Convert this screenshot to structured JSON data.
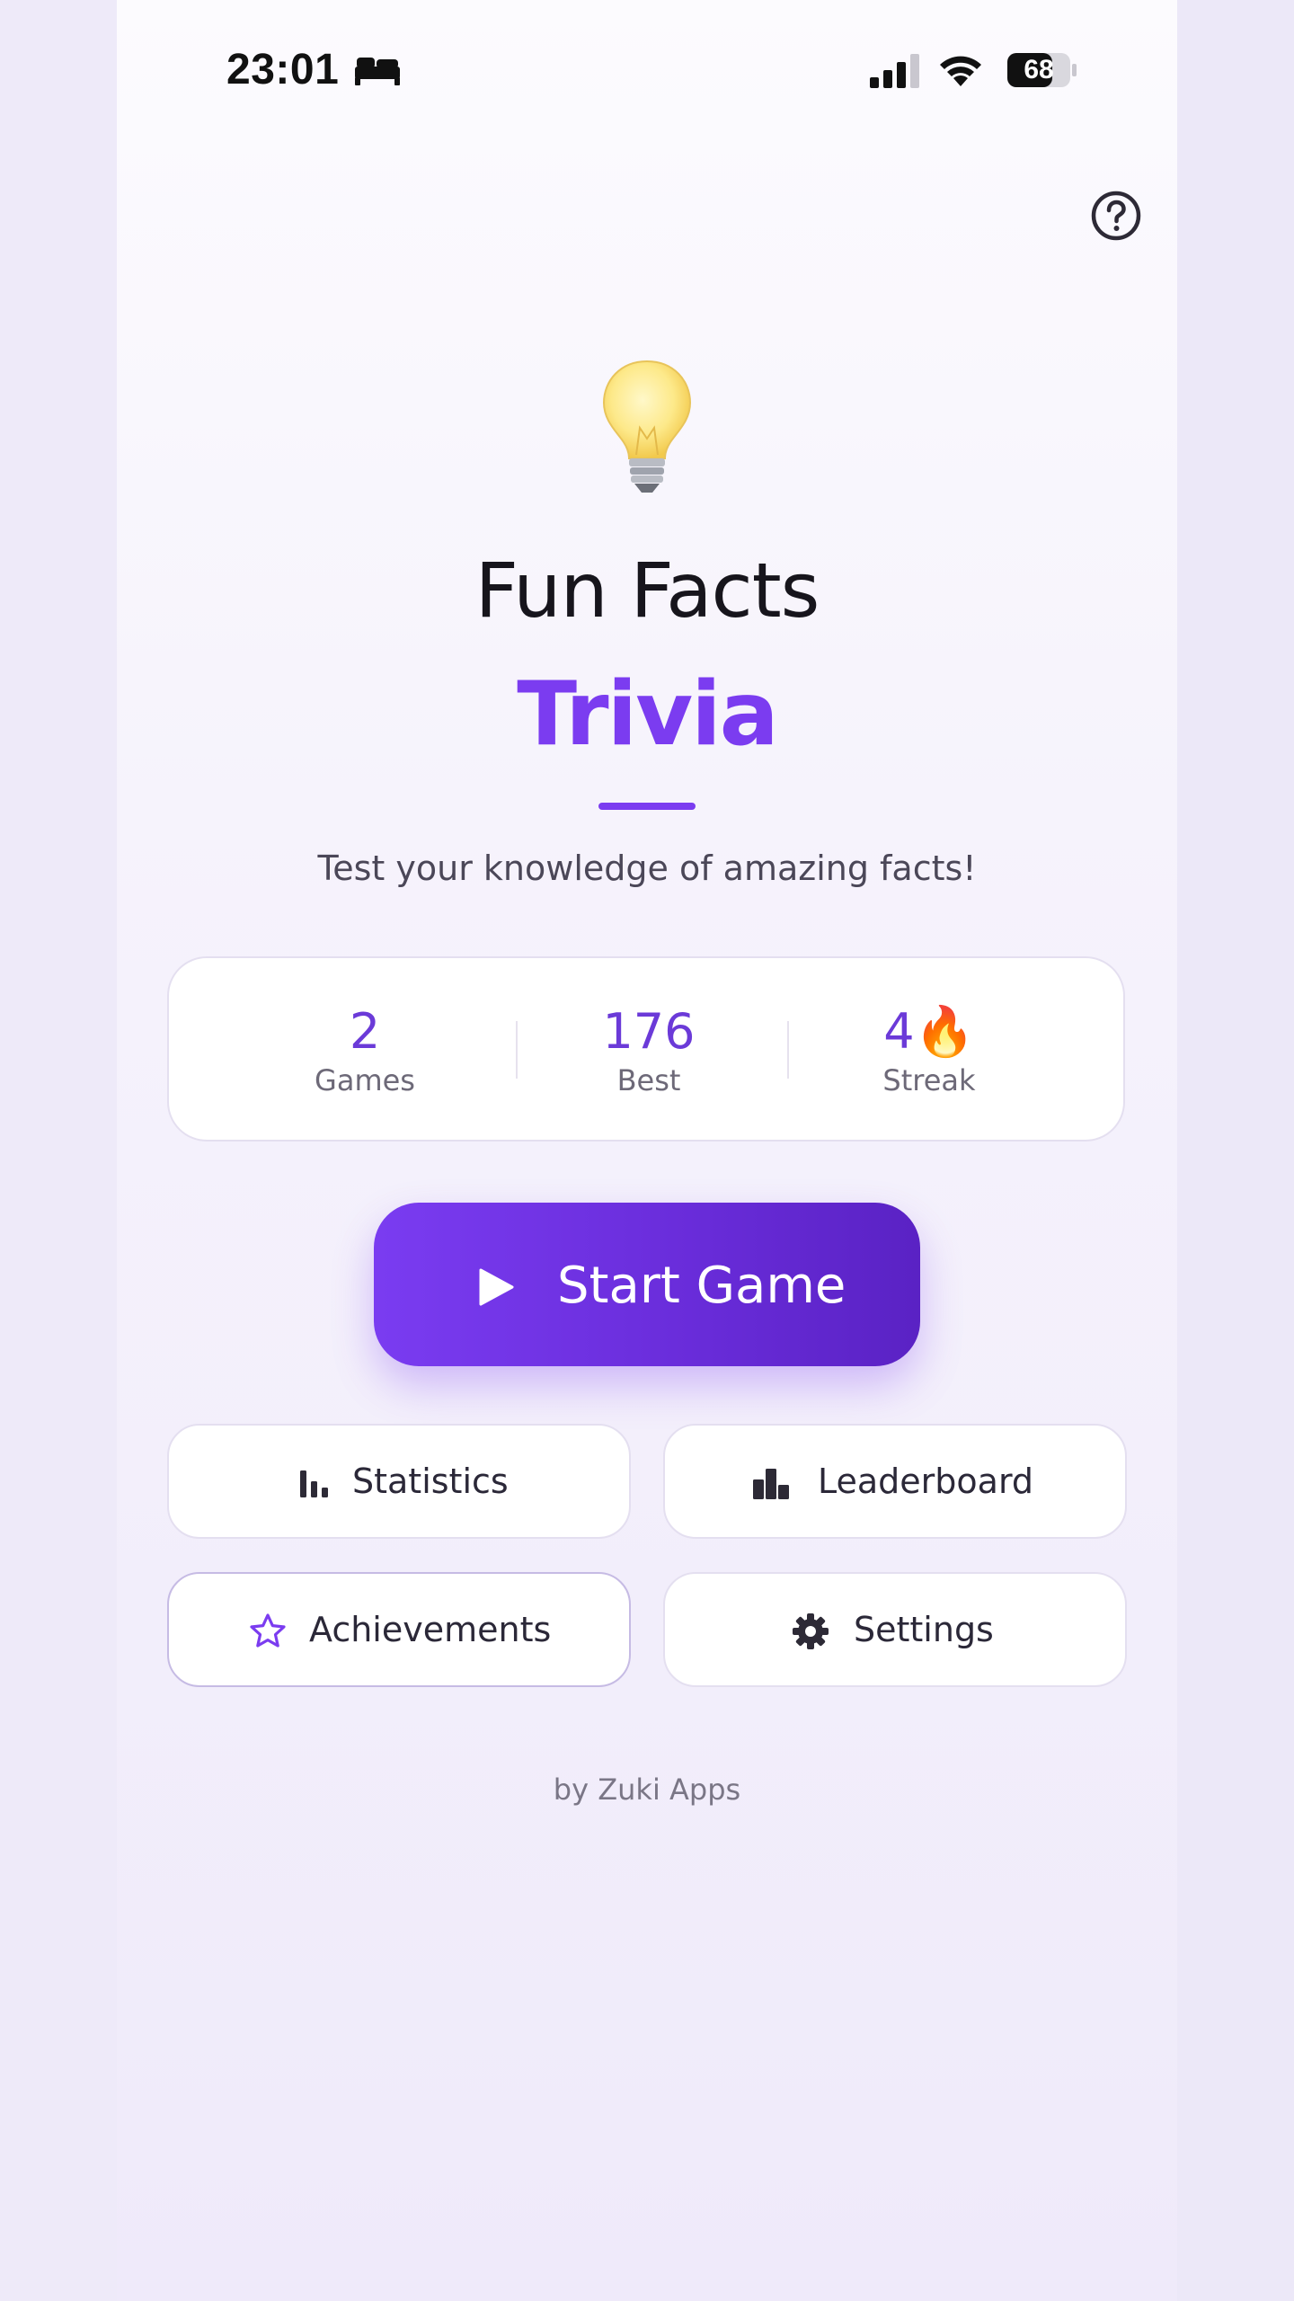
{
  "status_bar": {
    "time": "23:01",
    "battery": "68"
  },
  "header": {
    "help_icon": "question-circle-icon"
  },
  "hero": {
    "icon": "lightbulb-icon",
    "title": "Fun Facts",
    "title_accent": "Trivia",
    "subtitle": "Test your knowledge of amazing facts!"
  },
  "stats": [
    {
      "value": "2",
      "label": "Games"
    },
    {
      "value": "176",
      "label": "Best"
    },
    {
      "value": "4🔥",
      "label": "Streak"
    }
  ],
  "start_button": {
    "label": "Start Game",
    "icon": "play-icon"
  },
  "menu": [
    {
      "label": "Statistics",
      "icon": "bar-chart-icon"
    },
    {
      "label": "Leaderboard",
      "icon": "leaderboard-icon"
    },
    {
      "label": "Achievements",
      "icon": "star-icon"
    },
    {
      "label": "Settings",
      "icon": "gear-icon"
    }
  ],
  "footer": {
    "credit": "by Zuki Apps"
  },
  "colors": {
    "accent": "#7b3cf0",
    "accent_dark": "#5a22c4",
    "text_dark": "#17151c",
    "background": "#efeafa"
  }
}
